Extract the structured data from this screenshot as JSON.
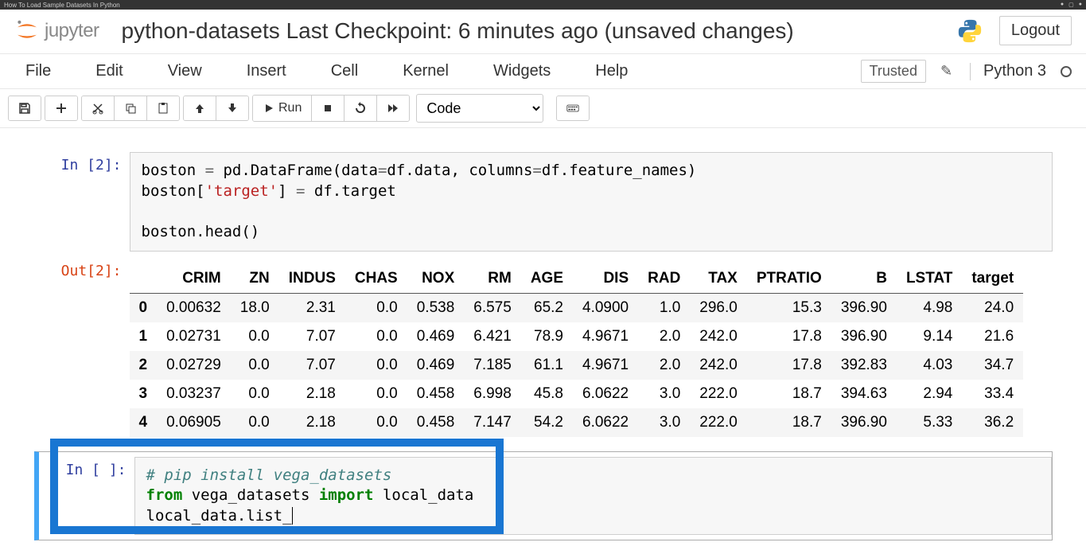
{
  "browser": {
    "tab_title": "How To Load Sample Datasets In Python"
  },
  "header": {
    "logo_text": "jupyter",
    "title": "python-datasets Last Checkpoint: 6 minutes ago  (unsaved changes)",
    "logout": "Logout"
  },
  "menu": {
    "items": [
      "File",
      "Edit",
      "View",
      "Insert",
      "Cell",
      "Kernel",
      "Widgets",
      "Help"
    ],
    "trusted": "Trusted",
    "kernel": "Python 3"
  },
  "toolbar": {
    "run_label": "Run",
    "cell_type_value": "Code"
  },
  "cells": {
    "in2_prompt": "In [2]:",
    "out2_prompt": "Out[2]:",
    "in2_code": {
      "line1_a": "boston ",
      "line1_b": " pd.DataFrame(data",
      "line1_c": "df.data, columns",
      "line1_d": "df.feature_names)",
      "line2_a": "boston[",
      "line2_b": "'target'",
      "line2_c": "] ",
      "line2_d": " df.target",
      "line3": "",
      "line4": "boston.head()",
      "eq": "="
    },
    "in_blank_prompt": "In [ ]:",
    "in_blank_code": {
      "line1": "# pip install vega_datasets",
      "line2_a": "from",
      "line2_b": " vega_datasets ",
      "line2_c": "import",
      "line2_d": " local_data",
      "line3": "local_data.list_"
    }
  },
  "chart_data": {
    "type": "table",
    "columns": [
      "CRIM",
      "ZN",
      "INDUS",
      "CHAS",
      "NOX",
      "RM",
      "AGE",
      "DIS",
      "RAD",
      "TAX",
      "PTRATIO",
      "B",
      "LSTAT",
      "target"
    ],
    "index": [
      "0",
      "1",
      "2",
      "3",
      "4"
    ],
    "rows": [
      [
        "0.00632",
        "18.0",
        "2.31",
        "0.0",
        "0.538",
        "6.575",
        "65.2",
        "4.0900",
        "1.0",
        "296.0",
        "15.3",
        "396.90",
        "4.98",
        "24.0"
      ],
      [
        "0.02731",
        "0.0",
        "7.07",
        "0.0",
        "0.469",
        "6.421",
        "78.9",
        "4.9671",
        "2.0",
        "242.0",
        "17.8",
        "396.90",
        "9.14",
        "21.6"
      ],
      [
        "0.02729",
        "0.0",
        "7.07",
        "0.0",
        "0.469",
        "7.185",
        "61.1",
        "4.9671",
        "2.0",
        "242.0",
        "17.8",
        "392.83",
        "4.03",
        "34.7"
      ],
      [
        "0.03237",
        "0.0",
        "2.18",
        "0.0",
        "0.458",
        "6.998",
        "45.8",
        "6.0622",
        "3.0",
        "222.0",
        "18.7",
        "394.63",
        "2.94",
        "33.4"
      ],
      [
        "0.06905",
        "0.0",
        "2.18",
        "0.0",
        "0.458",
        "7.147",
        "54.2",
        "6.0622",
        "3.0",
        "222.0",
        "18.7",
        "396.90",
        "5.33",
        "36.2"
      ]
    ]
  }
}
